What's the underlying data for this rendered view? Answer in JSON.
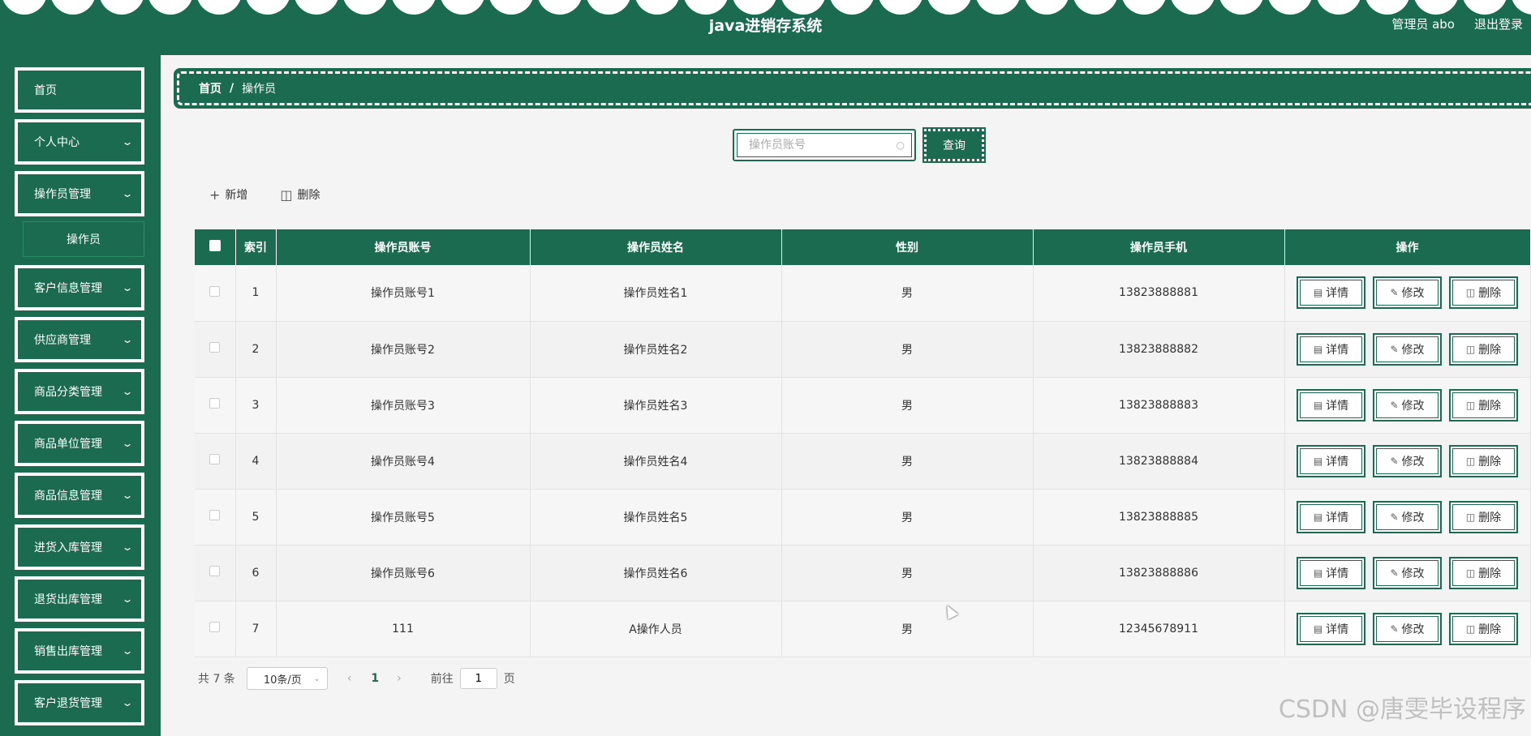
{
  "header": {
    "title": "java进销存系统",
    "user_label": "管理员 abo",
    "logout_label": "退出登录"
  },
  "sidebar": {
    "items": [
      {
        "label": "首页",
        "has_children": false
      },
      {
        "label": "个人中心",
        "has_children": true
      },
      {
        "label": "操作员管理",
        "has_children": true
      },
      {
        "label": "客户信息管理",
        "has_children": true
      },
      {
        "label": "供应商管理",
        "has_children": true
      },
      {
        "label": "商品分类管理",
        "has_children": true
      },
      {
        "label": "商品单位管理",
        "has_children": true
      },
      {
        "label": "商品信息管理",
        "has_children": true
      },
      {
        "label": "进货入库管理",
        "has_children": true
      },
      {
        "label": "退货出库管理",
        "has_children": true
      },
      {
        "label": "销售出库管理",
        "has_children": true
      },
      {
        "label": "客户退货管理",
        "has_children": true
      }
    ],
    "sub_item_label": "操作员"
  },
  "breadcrumb": {
    "home": "首页",
    "separator": "/",
    "current": "操作员"
  },
  "search": {
    "placeholder": "操作员账号",
    "value": "",
    "button_label": "查询"
  },
  "toolbar": {
    "add_label": "新增",
    "delete_label": "删除"
  },
  "table": {
    "columns": [
      "索引",
      "操作员账号",
      "操作员姓名",
      "性别",
      "操作员手机",
      "操作"
    ],
    "rows": [
      {
        "index": "1",
        "account": "操作员账号1",
        "name": "操作员姓名1",
        "gender": "男",
        "phone": "13823888881"
      },
      {
        "index": "2",
        "account": "操作员账号2",
        "name": "操作员姓名2",
        "gender": "男",
        "phone": "13823888882"
      },
      {
        "index": "3",
        "account": "操作员账号3",
        "name": "操作员姓名3",
        "gender": "男",
        "phone": "13823888883"
      },
      {
        "index": "4",
        "account": "操作员账号4",
        "name": "操作员姓名4",
        "gender": "男",
        "phone": "13823888884"
      },
      {
        "index": "5",
        "account": "操作员账号5",
        "name": "操作员姓名5",
        "gender": "男",
        "phone": "13823888885"
      },
      {
        "index": "6",
        "account": "操作员账号6",
        "name": "操作员姓名6",
        "gender": "男",
        "phone": "13823888886"
      },
      {
        "index": "7",
        "account": "111",
        "name": "A操作人员",
        "gender": "男",
        "phone": "12345678911"
      }
    ],
    "actions": {
      "detail": "详情",
      "edit": "修改",
      "delete": "删除"
    }
  },
  "pagination": {
    "total_label": "共 7 条",
    "page_size": "10条/页",
    "current_page": "1",
    "goto_prefix": "前往",
    "goto_value": "1",
    "goto_suffix": "页"
  },
  "watermark": "CSDN @唐雯毕设程序",
  "colors": {
    "primary": "#1a6b4f",
    "background": "#f4f4f4"
  }
}
